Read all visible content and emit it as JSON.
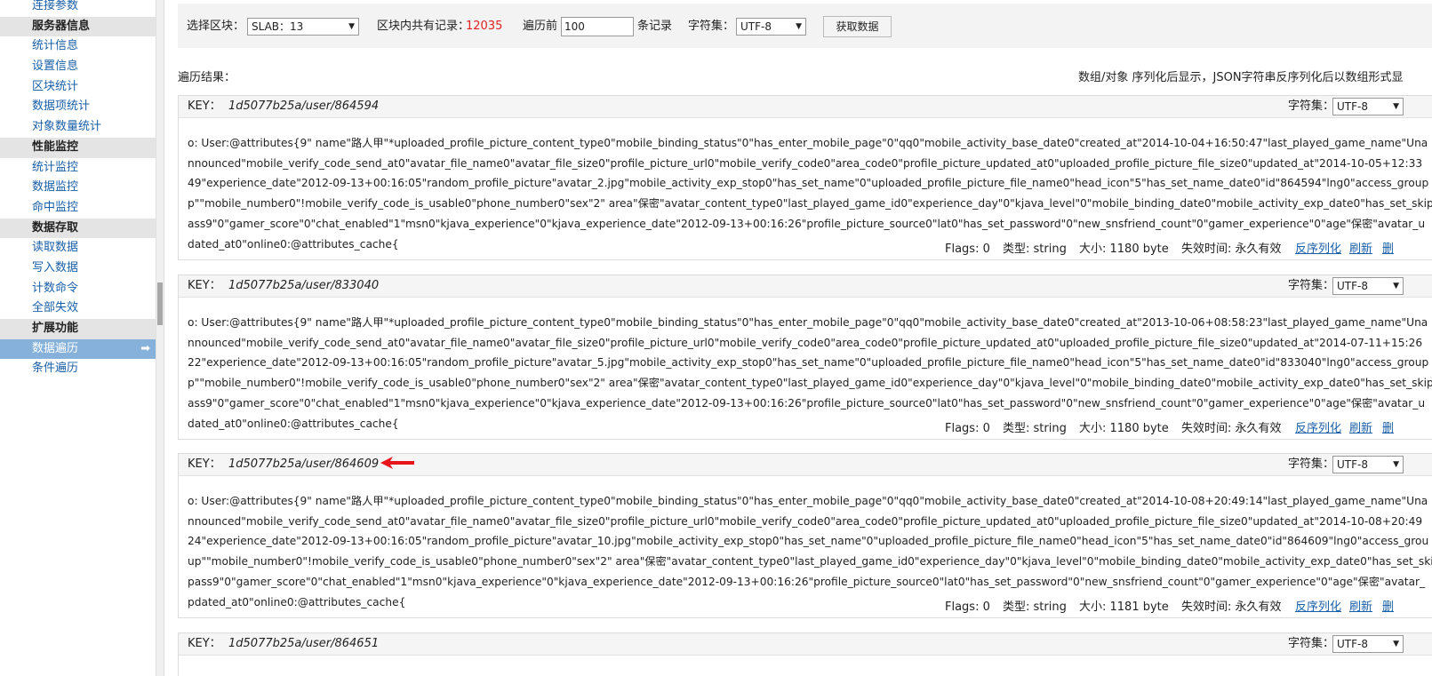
{
  "sidebar": {
    "items": [
      {
        "label": "连接参数",
        "type": "item"
      },
      {
        "label": "服务器信息",
        "type": "head"
      },
      {
        "label": "统计信息",
        "type": "item"
      },
      {
        "label": "设置信息",
        "type": "item"
      },
      {
        "label": "区块统计",
        "type": "item"
      },
      {
        "label": "数据项统计",
        "type": "item"
      },
      {
        "label": "对象数量统计",
        "type": "item"
      },
      {
        "label": "性能监控",
        "type": "head"
      },
      {
        "label": "统计监控",
        "type": "item"
      },
      {
        "label": "数据监控",
        "type": "item"
      },
      {
        "label": "命中监控",
        "type": "item"
      },
      {
        "label": "数据存取",
        "type": "head"
      },
      {
        "label": "读取数据",
        "type": "item"
      },
      {
        "label": "写入数据",
        "type": "item"
      },
      {
        "label": "计数命令",
        "type": "item"
      },
      {
        "label": "全部失效",
        "type": "item"
      },
      {
        "label": "扩展功能",
        "type": "head"
      },
      {
        "label": "数据遍历",
        "type": "active"
      },
      {
        "label": "条件遍历",
        "type": "item"
      }
    ],
    "active_arrow": "➡"
  },
  "toolbar": {
    "slab_label": "选择区块：",
    "slab_value": "SLAB：13",
    "records_label": "区块内共有记录：",
    "records_count": "12035",
    "traverse_label": "遍历前",
    "traverse_value": "100",
    "records_suffix": "条记录",
    "charset_label": "字符集：",
    "charset_value": "UTF-8",
    "fetch_button": "获取数据"
  },
  "results": {
    "label": "遍历结果：",
    "note": "数组/对象 序列化后显示，JSON字符串反序列化后以数组形式显"
  },
  "record_labels": {
    "key": "KEY：",
    "charset": "字符集：",
    "charset_value": "UTF-8",
    "flags": "Flags: 0",
    "type": "类型: string",
    "expire": "失效时间: 永久有效",
    "unserialize": "反序列化",
    "refresh": "刷新",
    "delete": "删"
  },
  "records": [
    {
      "key": "1d5077b25a/user/864594",
      "size": "大小: 1180 byte",
      "lines": [
        "o: User:@attributes{9\" name\"路人甲\"*uploaded_profile_picture_content_type0\"mobile_binding_status\"0\"has_enter_mobile_page\"0\"qq0\"mobile_activity_base_date0\"created_at\"2014-10-04+16:50:47\"last_played_game_name\"Una",
        "nnounced\"mobile_verify_code_send_at0\"avatar_file_name0\"avatar_file_size0\"profile_picture_url0\"mobile_verify_code0\"area_code0\"profile_picture_updated_at0\"uploaded_profile_picture_file_size0\"updated_at\"2014-10-05+12:33",
        "49\"experience_date\"2012-09-13+00:16:05\"random_profile_picture\"avatar_2.jpg\"mobile_activity_exp_stop0\"has_set_name\"0\"uploaded_profile_picture_file_name0\"head_icon\"5\"has_set_name_date0\"id\"864594\"lng0\"access_group",
        "p\"\"mobile_number0\"!mobile_verify_code_is_usable0\"phone_number0\"sex\"2\" area\"保密\"avatar_content_type0\"last_played_game_id0\"experience_day\"0\"kjava_level\"0\"mobile_binding_date0\"mobile_activity_exp_date0\"has_set_skip",
        "ass9\"0\"gamer_score\"0\"chat_enabled\"1\"msn0\"kjava_experience\"0\"kjava_experience_date\"2012-09-13+00:16:26\"profile_picture_source0\"lat0\"has_set_password\"0\"new_snsfriend_count\"0\"gamer_experience\"0\"age\"保密\"avatar_u",
        "dated_at0\"online0:@attributes_cache{"
      ]
    },
    {
      "key": "1d5077b25a/user/833040",
      "size": "大小: 1180 byte",
      "lines": [
        "o: User:@attributes{9\" name\"路人甲\"*uploaded_profile_picture_content_type0\"mobile_binding_status\"0\"has_enter_mobile_page\"0\"qq0\"mobile_activity_base_date0\"created_at\"2013-10-06+08:58:23\"last_played_game_name\"Una",
        "nnounced\"mobile_verify_code_send_at0\"avatar_file_name0\"avatar_file_size0\"profile_picture_url0\"mobile_verify_code0\"area_code0\"profile_picture_updated_at0\"uploaded_profile_picture_file_size0\"updated_at\"2014-07-11+15:26",
        "22\"experience_date\"2012-09-13+00:16:05\"random_profile_picture\"avatar_5.jpg\"mobile_activity_exp_stop0\"has_set_name\"0\"uploaded_profile_picture_file_name0\"head_icon\"5\"has_set_name_date0\"id\"833040\"lng0\"access_group",
        "p\"\"mobile_number0\"!mobile_verify_code_is_usable0\"phone_number0\"sex\"2\" area\"保密\"avatar_content_type0\"last_played_game_id0\"experience_day\"0\"kjava_level\"0\"mobile_binding_date0\"mobile_activity_exp_date0\"has_set_skip",
        "ass9\"0\"gamer_score\"0\"chat_enabled\"1\"msn0\"kjava_experience\"0\"kjava_experience_date\"2012-09-13+00:16:26\"profile_picture_source0\"lat0\"has_set_password\"0\"new_snsfriend_count\"0\"gamer_experience\"0\"age\"保密\"avatar_u",
        "dated_at0\"online0:@attributes_cache{"
      ]
    },
    {
      "key": "1d5077b25a/user/864609",
      "size": "大小: 1181 byte",
      "lines": [
        "o: User:@attributes{9\" name\"路人甲\"*uploaded_profile_picture_content_type0\"mobile_binding_status\"0\"has_enter_mobile_page\"0\"qq0\"mobile_activity_base_date0\"created_at\"2014-10-08+20:49:14\"last_played_game_name\"Una",
        "nnounced\"mobile_verify_code_send_at0\"avatar_file_name0\"avatar_file_size0\"profile_picture_url0\"mobile_verify_code0\"area_code0\"profile_picture_updated_at0\"uploaded_profile_picture_file_size0\"updated_at\"2014-10-08+20:49",
        "24\"experience_date\"2012-09-13+00:16:05\"random_profile_picture\"avatar_10.jpg\"mobile_activity_exp_stop0\"has_set_name\"0\"uploaded_profile_picture_file_name0\"head_icon\"5\"has_set_name_date0\"id\"864609\"lng0\"access_grou",
        "up\"\"mobile_number0\"!mobile_verify_code_is_usable0\"phone_number0\"sex\"2\" area\"保密\"avatar_content_type0\"last_played_game_id0\"experience_day\"0\"kjava_level\"0\"mobile_binding_date0\"mobile_activity_exp_date0\"has_set_ski",
        "pass9\"0\"gamer_score\"0\"chat_enabled\"1\"msn0\"kjava_experience\"0\"kjava_experience_date\"2012-09-13+00:16:26\"profile_picture_source0\"lat0\"has_set_password\"0\"new_snsfriend_count\"0\"gamer_experience\"0\"age\"保密\"avatar_",
        "pdated_at0\"online0:@attributes_cache{"
      ]
    },
    {
      "key": "1d5077b25a/user/864651",
      "size": "",
      "lines": []
    }
  ],
  "colors": {
    "link": "#1a5fa8",
    "active_nav": "#86b1da",
    "count_red": "#e02020",
    "annotation_arrow": "#e8141c"
  }
}
